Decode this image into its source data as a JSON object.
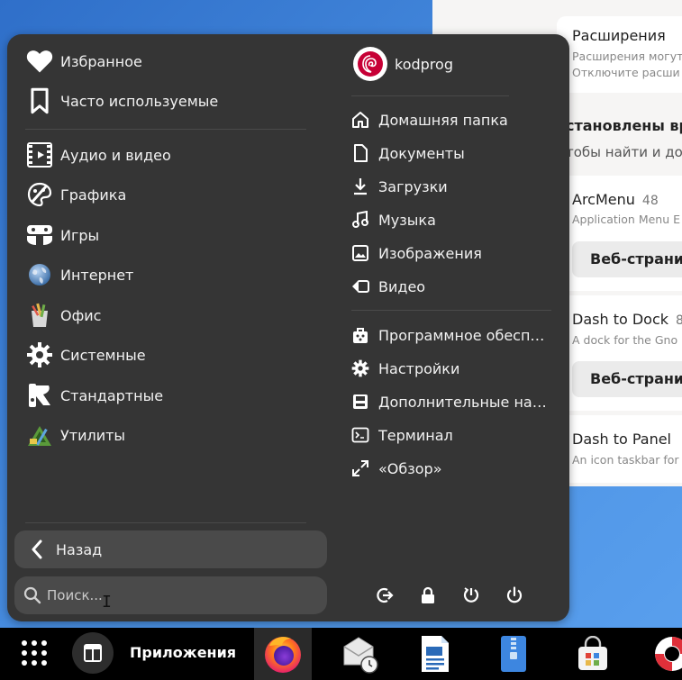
{
  "background_window": {
    "heading": "Расширения",
    "sub1": "Расширения могут",
    "sub2": "Отключите расши",
    "installed_heading": "становлены вру",
    "installed_sub": "тобы найти и до",
    "extensions": [
      {
        "name": "ArcMenu",
        "version": "48",
        "desc": "Application Menu E",
        "button": "Веб-страни"
      },
      {
        "name": "Dash to Dock",
        "version": "8",
        "desc": "A dock for the Gno",
        "button": "Веб-страни"
      },
      {
        "name": "Dash to Panel",
        "version": "",
        "desc": "An icon taskbar for",
        "button": ""
      }
    ]
  },
  "menu": {
    "categories": [
      {
        "label": "Избранное",
        "icon": "heart-icon"
      },
      {
        "label": "Часто используемые",
        "icon": "bookmark-icon"
      },
      {
        "label": "Аудио и видео",
        "icon": "film-icon"
      },
      {
        "label": "Графика",
        "icon": "palette-icon"
      },
      {
        "label": "Игры",
        "icon": "gamepad-icon"
      },
      {
        "label": "Интернет",
        "icon": "globe-icon"
      },
      {
        "label": "Офис",
        "icon": "office-icon"
      },
      {
        "label": "Системные",
        "icon": "gear-icon"
      },
      {
        "label": "Стандартные",
        "icon": "accessories-icon"
      },
      {
        "label": "Утилиты",
        "icon": "utilities-icon"
      }
    ],
    "user": {
      "name": "kodprog"
    },
    "places": [
      {
        "label": "Домашняя папка",
        "icon": "home-icon"
      },
      {
        "label": "Документы",
        "icon": "document-icon"
      },
      {
        "label": "Загрузки",
        "icon": "download-icon"
      },
      {
        "label": "Музыка",
        "icon": "music-icon"
      },
      {
        "label": "Изображения",
        "icon": "image-icon"
      },
      {
        "label": "Видео",
        "icon": "video-icon"
      }
    ],
    "shortcuts": [
      {
        "label": "Программное обеспечение",
        "icon": "software-icon"
      },
      {
        "label": "Настройки",
        "icon": "settings-icon"
      },
      {
        "label": "Дополнительные настройки",
        "icon": "tweaks-icon"
      },
      {
        "label": "Терминал",
        "icon": "terminal-icon"
      },
      {
        "label": "«Обзор»",
        "icon": "overview-icon"
      }
    ],
    "back_label": "Назад",
    "search_placeholder": "Поиск..."
  },
  "taskbar": {
    "apps_label": "Приложения"
  },
  "colors": {
    "menu_bg": "#353535",
    "button_bg": "#4a4a4a",
    "desktop_blue": "#3d7fd6"
  }
}
